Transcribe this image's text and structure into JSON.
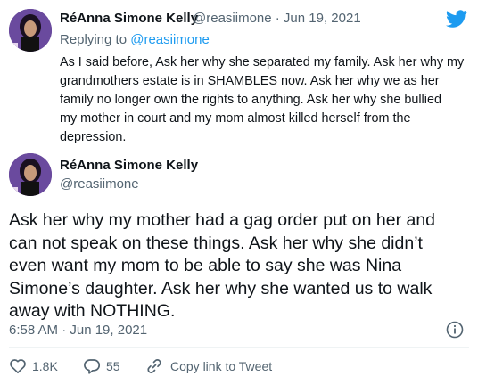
{
  "reply_tweet": {
    "author_name": "RéAnna Simone Kelly",
    "handle_date": "@reasiimone · Jun 19, 2021",
    "replying_to_label": "Replying to",
    "replying_to_handle": "@reasiimone",
    "lines": [
      "As I said before, Ask her why she separated my family. Ask her why my",
      "grandmothers estate is in SHAMBLES now. Ask her why we as her",
      "family no longer own the rights to anything. Ask her why she bullied",
      "my mother in court and my mom almost killed herself from the",
      "depression."
    ]
  },
  "main_tweet": {
    "author_name": "RéAnna Simone Kelly",
    "handle": "@reasiimone",
    "lines": [
      "Ask her why my mother had a gag order put on her and",
      "can not speak on these things. Ask her why she didn’t",
      "even want my mom to be able to say she was Nina",
      "Simone’s daughter. Ask her why she wanted us to walk",
      "away with NOTHING."
    ],
    "timestamp": "6:58 AM · Jun 19, 2021"
  },
  "actions": {
    "likes": "1.8K",
    "replies": "55",
    "copy_link_label": "Copy link to Tweet"
  },
  "colors": {
    "twitter_blue": "#1d9bf0",
    "muted_text": "#536471",
    "text": "#0f1419"
  },
  "icons": [
    "twitter-bird-icon",
    "info-icon",
    "heart-icon",
    "reply-icon",
    "link-icon"
  ]
}
